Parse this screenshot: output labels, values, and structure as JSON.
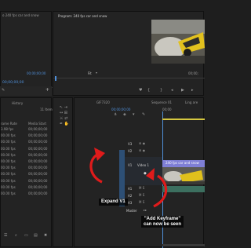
{
  "source_monitor": {
    "tab_label": "o 240 fps car and snow",
    "timecode": "00;00;00;00"
  },
  "program_monitor": {
    "tab_label": "Program: 240 fps car and snow",
    "timecode_left": "00;00;00;00",
    "fit_label": "Fit",
    "timecode_right": "00;00;"
  },
  "project_panel": {
    "tab_label": "History",
    "item_count": "11 Items",
    "col_frame_rate": "rame Rate",
    "col_media_start": "Media Start",
    "rows": [
      {
        "rate": "3.98 fps",
        "start": "00;00;00;00"
      },
      {
        "rate": "00.00 fps",
        "start": "00;00;00;00"
      },
      {
        "rate": "00.00 fps",
        "start": "00;00;00;00"
      },
      {
        "rate": "00.00 fps",
        "start": "00;00;00;00"
      },
      {
        "rate": "00.00 fps",
        "start": "00;00;00;00"
      },
      {
        "rate": "00.00 fps",
        "start": "00;00;00;00"
      },
      {
        "rate": "00.00 fps",
        "start": "00;00;00;00"
      },
      {
        "rate": "00.00 fps",
        "start": "00;00;00;00"
      },
      {
        "rate": "00.00 fps",
        "start": "00;00;00;00"
      },
      {
        "rate": "00.00 fps",
        "start": "00;00;00;00"
      },
      {
        "rate": "00.00 fps",
        "start": "00;00;00;00"
      }
    ]
  },
  "timeline": {
    "tabs": [
      "GIF7320",
      "Sequence 01",
      "Ling are"
    ],
    "timecode": "00;00;00;00",
    "ruler_start": "00;00",
    "tracks": [
      {
        "id": "V3",
        "label": "V3"
      },
      {
        "id": "V2",
        "label": "V2"
      },
      {
        "id": "V1",
        "label": "V1",
        "name": "Video 1"
      },
      {
        "id": "A1",
        "label": "A1"
      },
      {
        "id": "A2",
        "label": "A2"
      },
      {
        "id": "A3",
        "label": "A3"
      }
    ],
    "clip_label": "240 fps car and snow",
    "master_label": "Master"
  },
  "annotations": {
    "expand_v1": "Expand V1",
    "add_keyframe_line1": "\"Add Keyframe\"",
    "add_keyframe_line2": "can now be seen"
  },
  "colors": {
    "accent": "#4f8fd8",
    "arrow": "#e01b1b",
    "clip": "#7f7fd6",
    "track_active": "#2d4f75"
  }
}
